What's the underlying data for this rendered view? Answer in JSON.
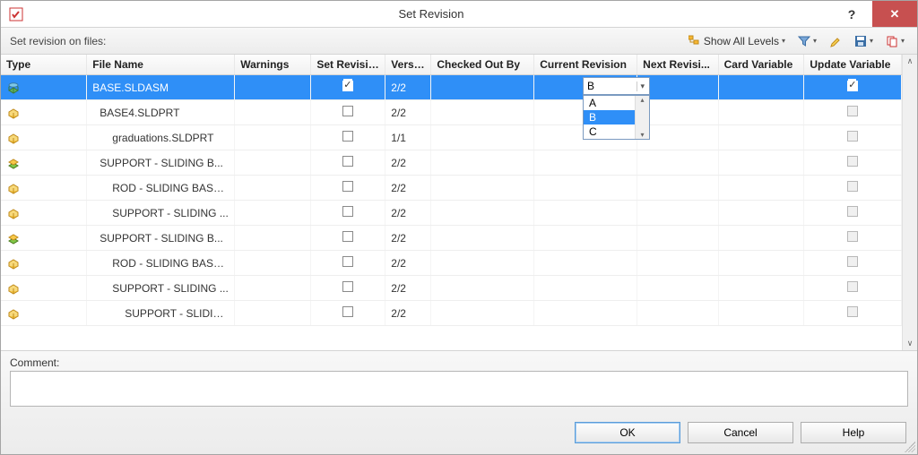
{
  "titlebar": {
    "title": "Set Revision"
  },
  "toolbar": {
    "label": "Set revision on files:",
    "show_all": "Show All Levels"
  },
  "columns": [
    "Type",
    "File Name",
    "Warnings",
    "Set Revision",
    "Versi...",
    "Checked Out By",
    "Current Revision",
    "Next Revisi...",
    "Card Variable",
    "Update Variable"
  ],
  "rows": [
    {
      "icon": "asm",
      "name": "BASE.SLDASM",
      "indent": 0,
      "set": true,
      "ver": "2/2",
      "next": "B",
      "upd": true,
      "sel": true
    },
    {
      "icon": "prt",
      "name": "BASE4.SLDPRT",
      "indent": 1,
      "set": false,
      "ver": "2/2",
      "next": "",
      "upd": false,
      "sel": false
    },
    {
      "icon": "prt",
      "name": "graduations.SLDPRT",
      "indent": 2,
      "set": false,
      "ver": "1/1",
      "next": "",
      "upd": false,
      "sel": false
    },
    {
      "icon": "asm2",
      "name": "SUPPORT - SLIDING B...",
      "indent": 1,
      "set": false,
      "ver": "2/2",
      "next": "",
      "upd": false,
      "sel": false
    },
    {
      "icon": "prt",
      "name": "ROD - SLIDING BASE ...",
      "indent": 2,
      "set": false,
      "ver": "2/2",
      "next": "",
      "upd": false,
      "sel": false
    },
    {
      "icon": "prt",
      "name": "SUPPORT - SLIDING ...",
      "indent": 2,
      "set": false,
      "ver": "2/2",
      "next": "",
      "upd": false,
      "sel": false
    },
    {
      "icon": "asm2",
      "name": "SUPPORT - SLIDING B...",
      "indent": 1,
      "set": false,
      "ver": "2/2",
      "next": "",
      "upd": false,
      "sel": false
    },
    {
      "icon": "prt",
      "name": "ROD - SLIDING BASE ...",
      "indent": 2,
      "set": false,
      "ver": "2/2",
      "next": "",
      "upd": false,
      "sel": false
    },
    {
      "icon": "prt",
      "name": "SUPPORT - SLIDING ...",
      "indent": 2,
      "set": false,
      "ver": "2/2",
      "next": "",
      "upd": false,
      "sel": false
    },
    {
      "icon": "prt",
      "name": "SUPPORT - SLIDIN...",
      "indent": 3,
      "set": false,
      "ver": "2/2",
      "next": "",
      "upd": false,
      "sel": false
    }
  ],
  "dropdown": {
    "value": "B",
    "options": [
      "A",
      "B",
      "C"
    ],
    "selected": "B"
  },
  "comment": {
    "label": "Comment:",
    "value": ""
  },
  "buttons": {
    "ok": "OK",
    "cancel": "Cancel",
    "help": "Help"
  }
}
